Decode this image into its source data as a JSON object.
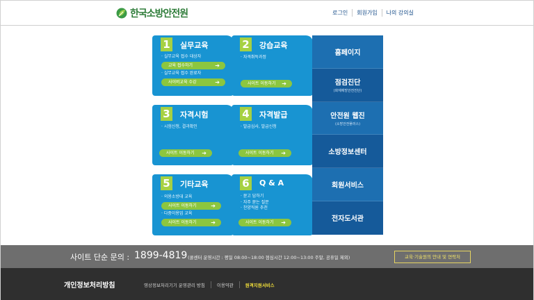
{
  "header": {
    "logo_text": "한국소방안전원",
    "nav": [
      "로그인",
      "회원가입",
      "나의 강의실"
    ]
  },
  "tiles": [
    {
      "num": "1",
      "title": "실무교육",
      "items": [
        {
          "text": "실무교육 접수 대상자",
          "button": "교육 접수하기"
        },
        {
          "text": "실무교육 접수 완료자",
          "button": "사이버교육 수강"
        }
      ]
    },
    {
      "num": "2",
      "title": "강습교육",
      "items": [
        {
          "text": "자격취득과정"
        }
      ],
      "button": "사이트 이동하기"
    },
    {
      "num": "3",
      "title": "자격시험",
      "items": [
        {
          "text": "시험신청, 결과확인"
        }
      ],
      "button": "사이트 이동하기"
    },
    {
      "num": "4",
      "title": "자격발급",
      "items": [
        {
          "text": "발급심사, 발급신청"
        }
      ],
      "button": "사이트 이동하기"
    },
    {
      "num": "5",
      "title": "기타교육",
      "items": [
        {
          "text": "의용소방대 교육",
          "button": "사이트 이동하기"
        },
        {
          "text": "다중이용업 교육",
          "button": "사이트 이동하기"
        }
      ]
    },
    {
      "num": "6",
      "title": "Q & A",
      "items": [
        {
          "text": "묻고 답하기"
        },
        {
          "text": "자주 묻는 질문"
        },
        {
          "text": "찬양직원 추천"
        }
      ],
      "button": "사이트 이동하기"
    }
  ],
  "side_menu": [
    {
      "label": "홈페이지",
      "sub": ""
    },
    {
      "label": "점검진단",
      "sub": "(화재예방안전진단)"
    },
    {
      "label": "안전원 웹진",
      "sub": "(소방안전플러스)"
    },
    {
      "label": "소방정보센터",
      "sub": ""
    },
    {
      "label": "회원서비스",
      "sub": ""
    },
    {
      "label": "전자도서관",
      "sub": ""
    }
  ],
  "contact": {
    "label": "사이트 단순 문의 :",
    "phone": "1899-4819",
    "hours": "(콜센터 운영시간 : 평일 08:00~18:00  점심시간 12:00~13:00  주말, 공휴일 제외)",
    "guide": "교육·기술원의 안내 및 연락처"
  },
  "footer": {
    "title": "개인정보처리방침",
    "links": [
      "영상정보처리기기 운영관리 방침",
      "이용약관",
      "원격지원서비스"
    ]
  },
  "colors": {
    "tile_blue": "#1894d2",
    "number_green": "#a6d142",
    "button_green": "#8cc63f",
    "side_blue": "#1d6fb1"
  }
}
